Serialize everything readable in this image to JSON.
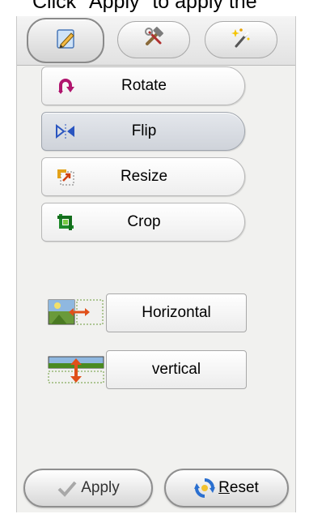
{
  "caption": "Click \"Apply\" to apply the",
  "tabs": [
    {
      "icon": "pencil-icon",
      "active": true
    },
    {
      "icon": "hammer-wrench-icon",
      "active": false
    },
    {
      "icon": "magic-wand-icon",
      "active": false
    }
  ],
  "tools": [
    {
      "label": "Rotate",
      "icon": "rotate-icon",
      "selected": false
    },
    {
      "label": "Flip",
      "icon": "flip-icon",
      "selected": true
    },
    {
      "label": "Resize",
      "icon": "resize-icon",
      "selected": false
    },
    {
      "label": "Crop",
      "icon": "crop-icon",
      "selected": false
    }
  ],
  "flip_options": {
    "horizontal_label": "Horizontal",
    "vertical_label": "vertical"
  },
  "footer": {
    "apply_label": "Apply",
    "reset_first_letter": "R",
    "reset_rest": "eset"
  },
  "colors": {
    "panel_bg": "#f1f1ef",
    "selected_bg": "#d4d8de"
  }
}
